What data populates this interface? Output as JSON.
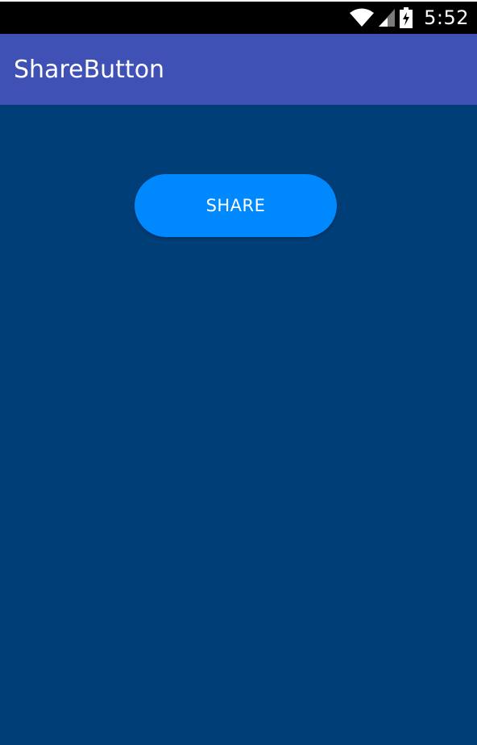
{
  "status_bar": {
    "time": "5:52",
    "icons": [
      "wifi-icon",
      "cellular-signal-icon",
      "battery-charging-icon"
    ]
  },
  "app_bar": {
    "title": "ShareButton"
  },
  "main": {
    "share_button_label": "SHARE"
  },
  "colors": {
    "status_bar": "#000000",
    "app_bar": "#3f51b5",
    "background": "#003e78",
    "button": "#0088ff",
    "text": "#ffffff"
  }
}
